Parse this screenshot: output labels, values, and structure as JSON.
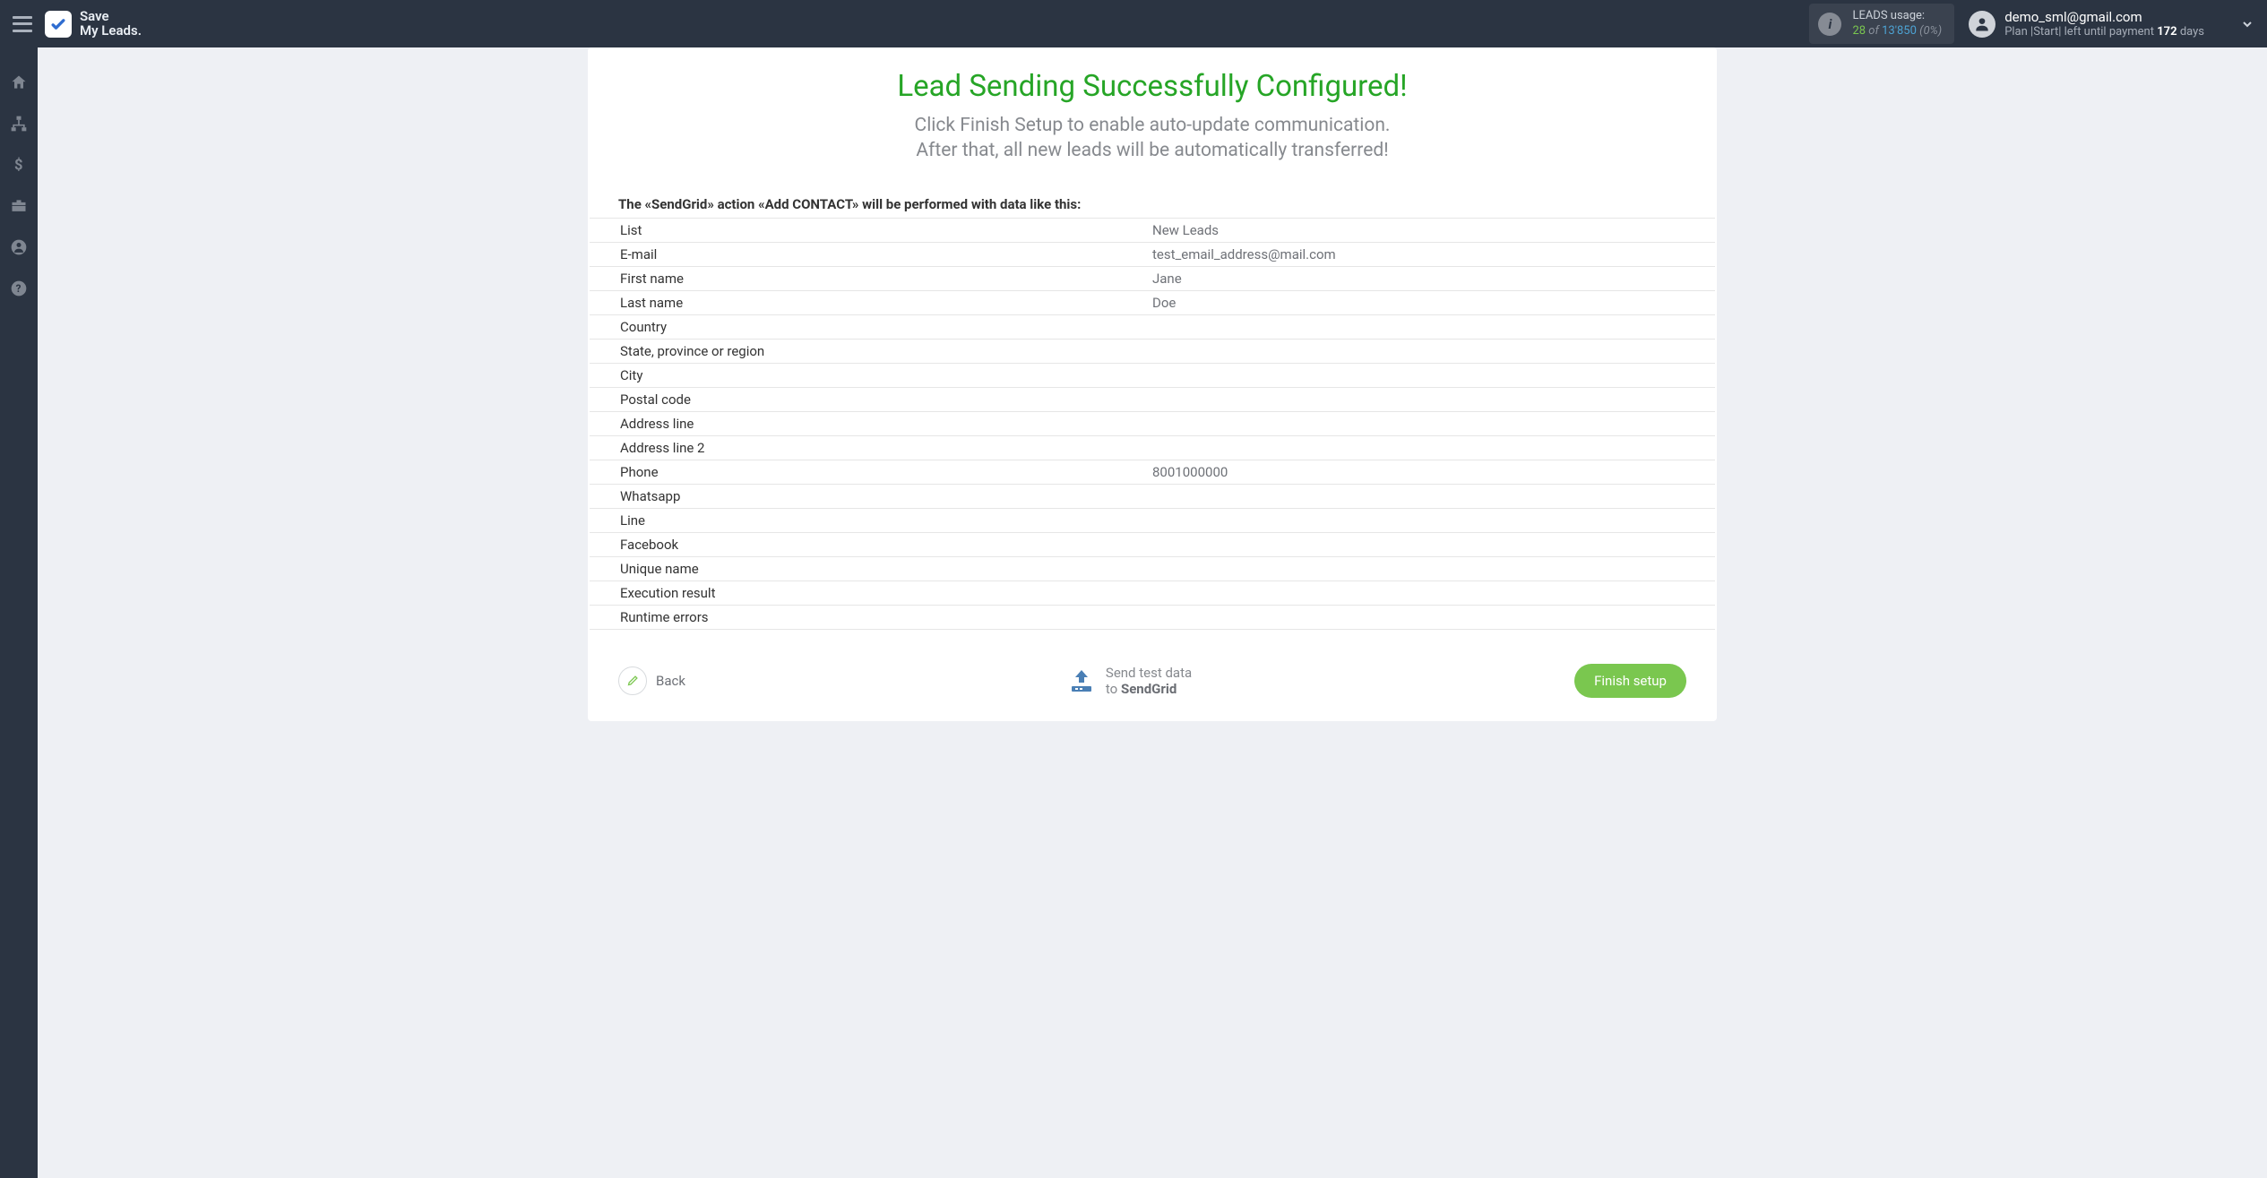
{
  "brand": {
    "line1": "Save",
    "line2": "My Leads."
  },
  "usage": {
    "label": "LEADS usage:",
    "used": "28",
    "of_word": "of",
    "total": "13'850",
    "pct": "(0%)"
  },
  "user": {
    "email": "demo_sml@gmail.com",
    "plan_prefix": "Plan |Start| left until payment ",
    "days_num": "172",
    "days_word": " days"
  },
  "main": {
    "title": "Lead Sending Successfully Configured!",
    "subtitle_l1": "Click Finish Setup to enable auto-update communication.",
    "subtitle_l2": "After that, all new leads will be automatically transferred!",
    "lead": "The «SendGrid» action «Add CONTACT» will be performed with data like this:"
  },
  "rows": [
    {
      "label": "List",
      "value": "New Leads"
    },
    {
      "label": "E-mail",
      "value": "test_email_address@mail.com"
    },
    {
      "label": "First name",
      "value": "Jane"
    },
    {
      "label": "Last name",
      "value": "Doe"
    },
    {
      "label": "Country",
      "value": ""
    },
    {
      "label": "State, province or region",
      "value": ""
    },
    {
      "label": "City",
      "value": ""
    },
    {
      "label": "Postal code",
      "value": ""
    },
    {
      "label": "Address line",
      "value": ""
    },
    {
      "label": "Address line 2",
      "value": ""
    },
    {
      "label": "Phone",
      "value": "8001000000"
    },
    {
      "label": "Whatsapp",
      "value": ""
    },
    {
      "label": "Line",
      "value": ""
    },
    {
      "label": "Facebook",
      "value": ""
    },
    {
      "label": "Unique name",
      "value": ""
    },
    {
      "label": "Execution result",
      "value": ""
    },
    {
      "label": "Runtime errors",
      "value": ""
    }
  ],
  "actions": {
    "back": "Back",
    "send_l1": "Send test data",
    "send_l2a": "to ",
    "send_l2b": "SendGrid",
    "finish": "Finish setup"
  }
}
